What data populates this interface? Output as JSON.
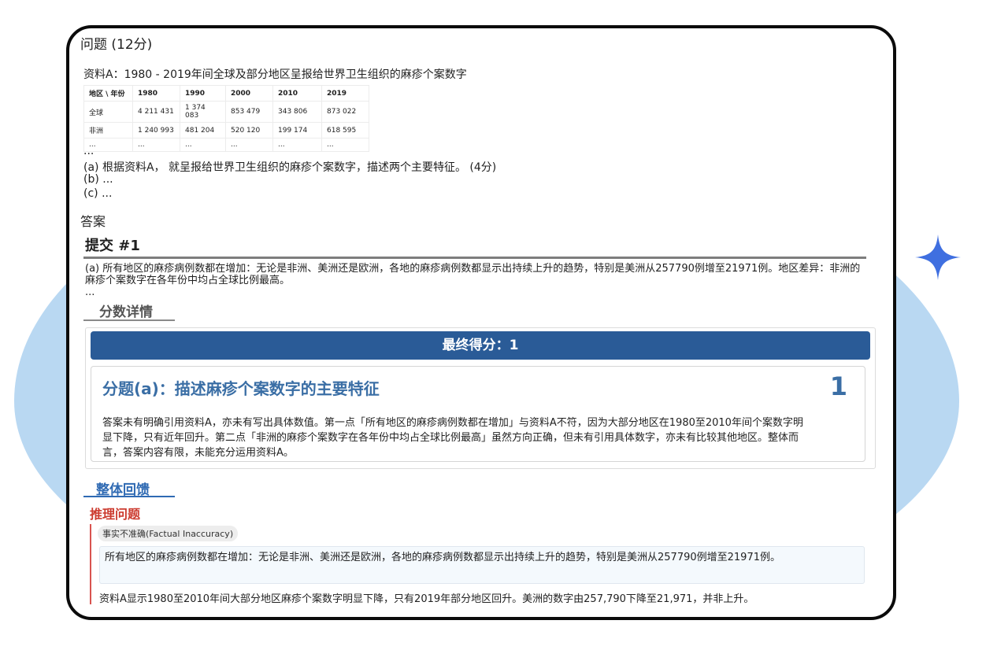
{
  "question": {
    "header": "问题 (12分)",
    "source_title": "资料A：1980 - 2019年间全球及部分地区呈报给世界卫生组织的麻疹个案数字",
    "table": {
      "headers": [
        "地区 \\ 年份",
        "1980",
        "1990",
        "2000",
        "2010",
        "2019"
      ],
      "rows": [
        [
          "全球",
          "4 211 431",
          "1 374 083",
          "853 479",
          "343 806",
          "873 022"
        ],
        [
          "非洲",
          "1 240 993",
          "481 204",
          "520 120",
          "199 174",
          "618 595"
        ],
        [
          "...",
          "...",
          "...",
          "...",
          "...",
          "..."
        ]
      ]
    },
    "ellipsis": "...",
    "part_a": "(a) 根据资料A， 就呈报给世界卫生组织的麻疹个案数字，描述两个主要特征。 (4分)",
    "part_b": "(b) ...",
    "part_c": "(c) ..."
  },
  "answer": {
    "header": "答案",
    "submission_title": "提交 #1",
    "text": "(a) 所有地区的麻疹病例数都在增加：无论是非洲、美洲还是欧洲，各地的麻疹病例数都显示出持续上升的趋势，特别是美洲从257790例增至21971例。地区差异：非洲的麻疹个案数字在各年份中均占全球比例最高。",
    "more": "..."
  },
  "score": {
    "tab_label": "分数详情",
    "final_label": "最终得分：1",
    "sub_title": "分题(a)：描述麻疹个案数字的主要特征",
    "sub_score": "1",
    "sub_feedback": "答案未有明确引用资料A，亦未有写出具体数值。第一点「所有地区的麻疹病例数都在增加」与资料A不符，因为大部分地区在1980至2010年间个案数字明显下降，只有近年回升。第二点「非洲的麻疹个案数字在各年份中均占全球比例最高」虽然方向正确，但未有引用具体数字，亦未有比较其他地区。整体而言，答案内容有限，未能充分运用资料A。"
  },
  "feedback": {
    "tab_label": "整体回馈",
    "issues_title": "推理问题",
    "issue_tag": "事实不准确(Factual Inaccuracy)",
    "issue_quote": "所有地区的麻疹病例数都在增加：无论是非洲、美洲还是欧洲，各地的麻疹病例数都显示出持续上升的趋势，特别是美洲从257790例增至21971例。",
    "issue_explanation": "资料A显示1980至2010年间大部分地区麻疹个案数字明显下降，只有2019年部分地区回升。美洲的数字由257,790下降至21,971，并非上升。"
  },
  "colors": {
    "final_bar": "#2a5b97",
    "accent_blue": "#3a6ea5",
    "issue_red": "#cc3b2f",
    "background_blob": "#b9d8f2",
    "sparkle": "#3f6fe0"
  },
  "icons": [
    "sparkle-icon"
  ]
}
